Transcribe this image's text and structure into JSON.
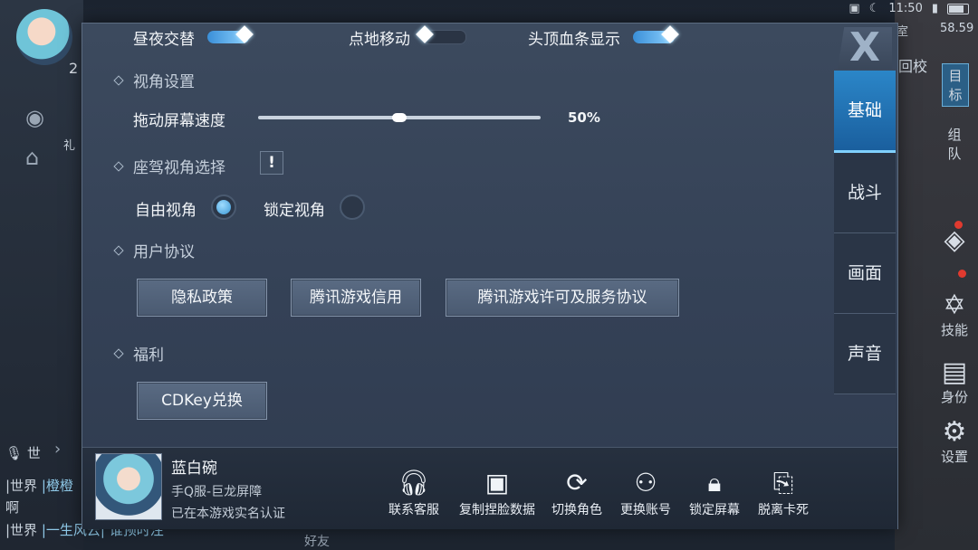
{
  "status_bar": {
    "time": "11:50",
    "extra": "58.59"
  },
  "hud": {
    "level": "2",
    "right_text_top": "回校",
    "right_text_2": "室",
    "target_label": "目标",
    "team_label": "组队",
    "gift_label": "礼",
    "skill_label": "技能",
    "identity_label": "身份",
    "settings_label": "设置",
    "chat_channel": "世",
    "chat_lines": [
      {
        "channel": "|世界",
        "text": "|橙橙"
      },
      {
        "channel": "啊",
        "text": ""
      },
      {
        "channel": "|世界",
        "text": "|一生风云| 谁预时注"
      }
    ],
    "friend_label": "好友"
  },
  "toggles": [
    {
      "label": "昼夜交替",
      "state": "on"
    },
    {
      "label": "点地移动",
      "state": "off"
    },
    {
      "label": "头顶血条显示",
      "state": "on"
    }
  ],
  "sections": {
    "view_settings": "视角设置",
    "drag_speed_label": "拖动屏幕速度",
    "drag_speed_value": "50%",
    "drag_speed_fraction": 0.5,
    "seat_view": "座驾视角选择",
    "warn_symbol": "!",
    "free_view": "自由视角",
    "lock_view": "锁定视角",
    "user_agreement": "用户协议",
    "welfare": "福利"
  },
  "buttons": {
    "privacy": "隐私政策",
    "credit": "腾讯游戏信用",
    "license": "腾讯游戏许可及服务协议",
    "cdkey": "CDKey兑换"
  },
  "tabs": [
    "基础",
    "战斗",
    "画面",
    "声音"
  ],
  "active_tab": "基础",
  "close_label": "X",
  "profile": {
    "name": "蓝白碗",
    "server": "手Q服-巨龙屏障",
    "verified": "已在本游戏实名认证"
  },
  "footer_actions": [
    {
      "label": "联系客服",
      "icon": "headset-icon"
    },
    {
      "label": "复制捏脸数据",
      "icon": "save-icon"
    },
    {
      "label": "切换角色",
      "icon": "switch-user-icon"
    },
    {
      "label": "更换账号",
      "icon": "account-icon"
    },
    {
      "label": "锁定屏幕",
      "icon": "lock-icon"
    },
    {
      "label": "脱离卡死",
      "icon": "exit-icon"
    }
  ]
}
